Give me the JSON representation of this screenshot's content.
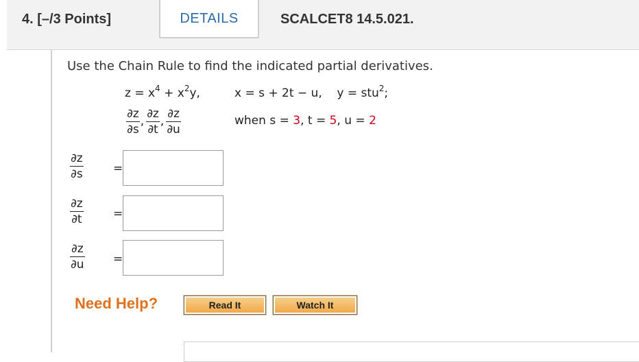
{
  "header": {
    "question_label": "4.  [–/3 Points]",
    "details_label": "DETAILS",
    "course_code": "SCALCET8 14.5.021."
  },
  "problem": {
    "intro": "Use the Chain Rule to find the indicated partial derivatives.",
    "z_eq_prefix": "z = x",
    "z_eq_exp1": "4",
    "z_eq_mid": " + x",
    "z_eq_exp2": "2",
    "z_eq_suffix": "y,",
    "x_eq": "x = s + 2t − u,",
    "y_eq_prefix": "y = stu",
    "y_eq_exp": "2",
    "y_eq_suffix": ";",
    "partials": [
      {
        "num": "∂z",
        "den": "∂s"
      },
      {
        "num": "∂z",
        "den": "∂t"
      },
      {
        "num": "∂z",
        "den": "∂u"
      }
    ],
    "comma": ",",
    "when_label": "when s = ",
    "s_value": "3",
    "t_label": ", t = ",
    "t_value": "5",
    "u_label": ", u = ",
    "u_value": "2"
  },
  "answers": [
    {
      "num": "∂z",
      "den": "∂s",
      "eq": "=",
      "value": ""
    },
    {
      "num": "∂z",
      "den": "∂t",
      "eq": "=",
      "value": ""
    },
    {
      "num": "∂z",
      "den": "∂u",
      "eq": "=",
      "value": ""
    }
  ],
  "help": {
    "label": "Need Help?",
    "read_it": "Read It",
    "watch_it": "Watch It"
  },
  "colors": {
    "accent_blue": "#2a6aa8",
    "help_orange": "#e0711c",
    "given_red": "#d0021b"
  }
}
